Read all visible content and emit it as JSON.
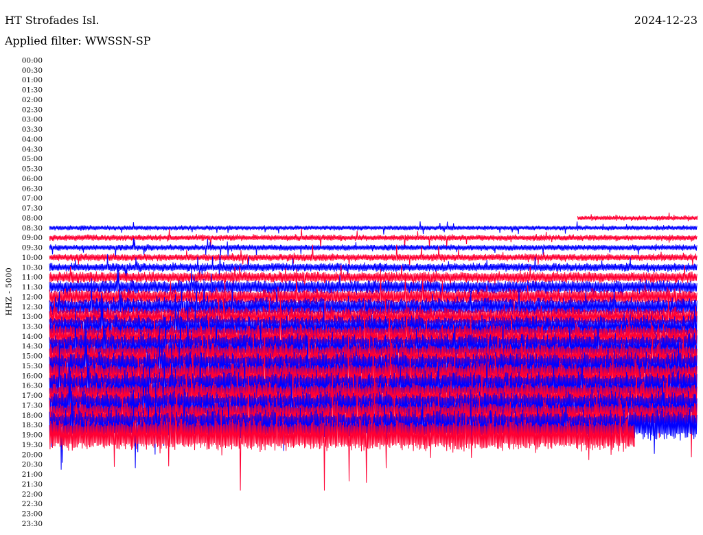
{
  "header": {
    "station": "HT Strofades Isl.",
    "date": "2024-12-23",
    "filter": "Applied filter: WWSSN-SP"
  },
  "chart_data": {
    "type": "line",
    "title": "HT Strofades Isl.",
    "ylabel": "HHZ - 5000",
    "y_tick_labels": [
      "00:00",
      "00:30",
      "01:00",
      "01:30",
      "02:00",
      "02:30",
      "03:00",
      "03:30",
      "04:00",
      "04:30",
      "05:00",
      "05:30",
      "06:00",
      "06:30",
      "07:00",
      "07:30",
      "08:00",
      "08:30",
      "09:00",
      "09:30",
      "10:00",
      "10:30",
      "11:00",
      "11:30",
      "12:00",
      "12:30",
      "13:00",
      "13:30",
      "14:00",
      "14:30",
      "15:00",
      "15:30",
      "16:00",
      "16:30",
      "17:00",
      "17:30",
      "18:00",
      "18:30",
      "19:00",
      "19:30",
      "20:00",
      "20:30",
      "21:00",
      "21:30",
      "22:00",
      "22:30",
      "23:00",
      "23:30"
    ],
    "trace_colors": [
      "#ff0033",
      "#0000ff"
    ],
    "traces": [
      {
        "row": "08:00",
        "start": 0.815,
        "end": 1.0,
        "amplitude": 4
      },
      {
        "row": "08:30",
        "start": 0.0,
        "end": 1.0,
        "amplitude": 4
      },
      {
        "row": "09:00",
        "start": 0.0,
        "end": 1.0,
        "amplitude": 5
      },
      {
        "row": "09:30",
        "start": 0.0,
        "end": 1.0,
        "amplitude": 5
      },
      {
        "row": "10:00",
        "start": 0.0,
        "end": 1.0,
        "amplitude": 6
      },
      {
        "row": "10:30",
        "start": 0.0,
        "end": 1.0,
        "amplitude": 7
      },
      {
        "row": "11:00",
        "start": 0.0,
        "end": 1.0,
        "amplitude": 9
      },
      {
        "row": "11:30",
        "start": 0.0,
        "end": 1.0,
        "amplitude": 11
      },
      {
        "row": "12:00",
        "start": 0.0,
        "end": 1.0,
        "amplitude": 13
      },
      {
        "row": "12:30",
        "start": 0.0,
        "end": 1.0,
        "amplitude": 15
      },
      {
        "row": "13:00",
        "start": 0.0,
        "end": 1.0,
        "amplitude": 16
      },
      {
        "row": "13:30",
        "start": 0.0,
        "end": 1.0,
        "amplitude": 18
      },
      {
        "row": "14:00",
        "start": 0.0,
        "end": 1.0,
        "amplitude": 19
      },
      {
        "row": "14:30",
        "start": 0.0,
        "end": 1.0,
        "amplitude": 20
      },
      {
        "row": "15:00",
        "start": 0.0,
        "end": 1.0,
        "amplitude": 21
      },
      {
        "row": "15:30",
        "start": 0.0,
        "end": 1.0,
        "amplitude": 22
      },
      {
        "row": "16:00",
        "start": 0.0,
        "end": 1.0,
        "amplitude": 22
      },
      {
        "row": "16:30",
        "start": 0.0,
        "end": 1.0,
        "amplitude": 22
      },
      {
        "row": "17:00",
        "start": 0.0,
        "end": 1.0,
        "amplitude": 22
      },
      {
        "row": "17:30",
        "start": 0.0,
        "end": 1.0,
        "amplitude": 22
      },
      {
        "row": "18:00",
        "start": 0.0,
        "end": 1.0,
        "amplitude": 22
      },
      {
        "row": "18:30",
        "start": 0.0,
        "end": 1.0,
        "amplitude": 24
      },
      {
        "row": "19:00",
        "start": 0.0,
        "end": 0.903,
        "amplitude": 26
      }
    ]
  }
}
